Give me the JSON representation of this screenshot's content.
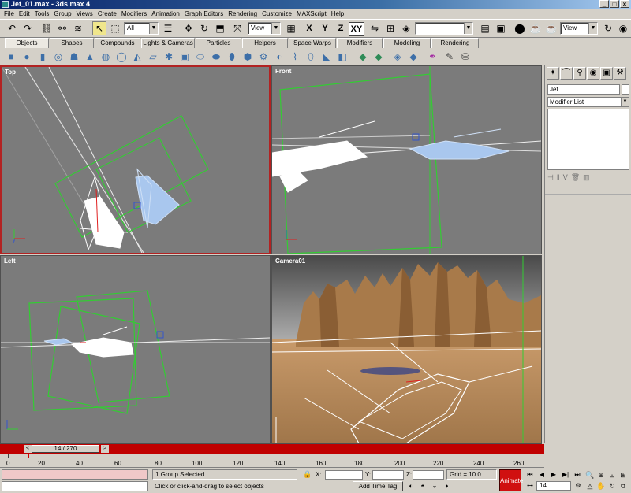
{
  "window": {
    "title": "Jet_01.max - 3ds max 4",
    "controls": [
      "_",
      "□",
      "×"
    ]
  },
  "menu": [
    "File",
    "Edit",
    "Tools",
    "Group",
    "Views",
    "Create",
    "Modifiers",
    "Animation",
    "Graph Editors",
    "Rendering",
    "Customize",
    "MAXScript",
    "Help"
  ],
  "toolbar": {
    "selection_filter": "All",
    "ref_coord": "View",
    "axis_x": "X",
    "axis_y": "Y",
    "axis_z": "Z",
    "axis_xy": "XY",
    "named_selection": "",
    "render_view": "View"
  },
  "tabs": [
    "Objects",
    "Shapes",
    "Compounds",
    "Lights & Cameras",
    "Particles",
    "Helpers",
    "Space Warps",
    "Modifiers",
    "Modeling",
    "Rendering"
  ],
  "active_tab": "Objects",
  "viewports": {
    "top": "Top",
    "front": "Front",
    "left": "Left",
    "camera": "Camera01"
  },
  "panel": {
    "object_name": "Jet",
    "modifier_list": "Modifier List"
  },
  "time": {
    "slider_label": "14 / 270",
    "current_frame": 14,
    "total_frames": 270,
    "ticks": [
      "0",
      "20",
      "40",
      "60",
      "80",
      "100",
      "120",
      "140",
      "160",
      "180",
      "200",
      "220",
      "240",
      "260"
    ]
  },
  "status": {
    "selection": "1 Group Selected",
    "prompt": "Click or click-and-drag to select objects",
    "add_time_tag": "Add Time Tag",
    "x_label": "X:",
    "y_label": "Y:",
    "z_label": "Z:",
    "grid": "Grid = 10.0",
    "animate": "Animate",
    "frame": "14"
  },
  "colors": {
    "active_border": "#b22222",
    "viewport_bg": "#7b7b7b",
    "time_slider": "#c00000",
    "animate_button": "#d01010",
    "wireframe_white": "#ffffff",
    "wireframe_blue": "#a9c7ee",
    "camera_cone": "#2ecc2e"
  }
}
